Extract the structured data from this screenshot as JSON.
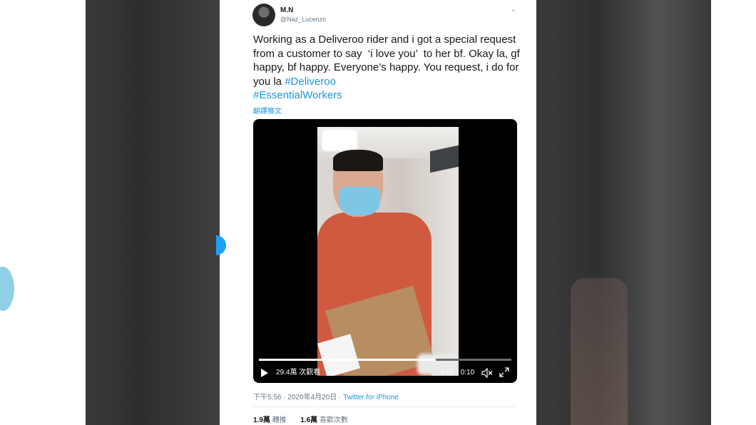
{
  "user": {
    "display_name": "M.N",
    "handle": "@Naz_Lucenzo"
  },
  "tweet": {
    "text_1": "Working as a Deliveroo rider and i got a special request from a customer to say  ‘i love you’  to her bf. Okay la, gf happy, bf happy. Everyone’s happy. You request, i do for you la ",
    "hashtag_1": "#Deliveroo",
    "hashtag_2": "#EssentialWorkers",
    "translate_label": "翻譯推文"
  },
  "video": {
    "views_text": "29.4萬 次觀看",
    "time_text": "0:07 / 0:10",
    "progress": 0.7
  },
  "meta": {
    "timestamp": "下午5:56 · 2020年4月20日 · ",
    "source": "Twitter for iPhone"
  },
  "stats": {
    "retweets_count": "1.9萬",
    "retweets_label": "轉推",
    "likes_count": "1.6萬",
    "likes_label": "喜歡次數"
  },
  "icons": [
    "chevron-down-icon",
    "play-icon",
    "volume-muted-icon",
    "fullscreen-icon"
  ],
  "colors": {
    "link": "#1b95e0",
    "accent": "#1da1f2"
  }
}
